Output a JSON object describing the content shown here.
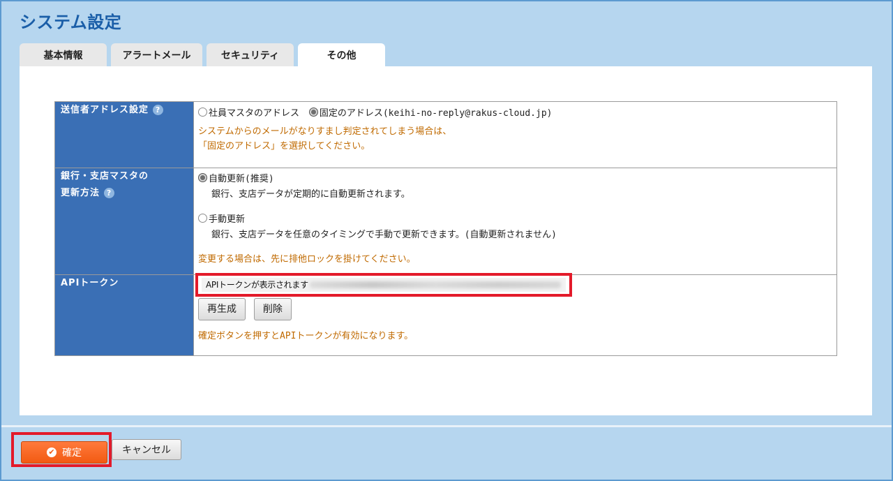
{
  "page": {
    "title": "システム設定"
  },
  "tabs": [
    {
      "label": "基本情報",
      "active": false
    },
    {
      "label": "アラートメール",
      "active": false
    },
    {
      "label": "セキュリティ",
      "active": false
    },
    {
      "label": "その他",
      "active": true
    }
  ],
  "sender": {
    "label": "送信者アドレス設定",
    "option_employee": "社員マスタのアドレス",
    "option_fixed": "固定のアドレス(keihi-no-reply@rakus-cloud.jp)",
    "selected": "fixed",
    "note_1": "システムからのメールがなりすまし判定されてしまう場合は、",
    "note_2": "「固定のアドレス」を選択してください。"
  },
  "bank": {
    "label_line1": "銀行・支店マスタの",
    "label_line2": "更新方法",
    "option_auto": "自動更新(推奨)",
    "option_auto_desc": "銀行、支店データが定期的に自動更新されます。",
    "option_manual": "手動更新",
    "option_manual_desc": "銀行、支店データを任意のタイミングで手動で更新できます。(自動更新されません)",
    "selected": "auto",
    "note": "変更する場合は、先に排他ロックを掛けてください。"
  },
  "api": {
    "label": "APIトークン",
    "token_text": "APIトークンが表示されます",
    "regenerate_label": "再生成",
    "delete_label": "削除",
    "note": "確定ボタンを押すとAPIトークンが有効になります。"
  },
  "footer": {
    "confirm_label": "確定",
    "cancel_label": "キャンセル"
  },
  "colors": {
    "header_blue": "#3a6fb5",
    "note_orange": "#c06a00",
    "confirm_orange": "#f25a12",
    "highlight_red": "#e31a2a",
    "background": "#b6d6ef"
  }
}
